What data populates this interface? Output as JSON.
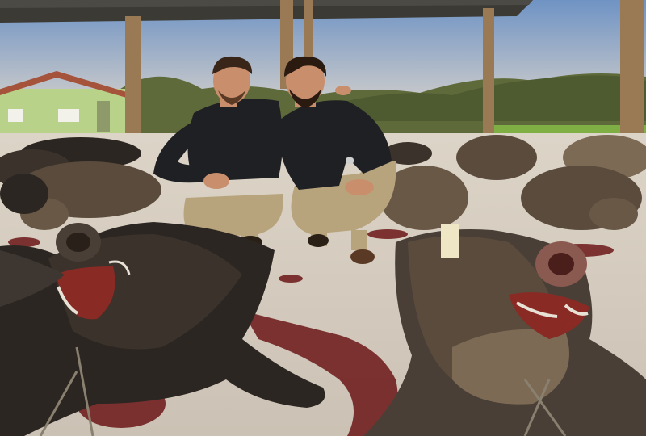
{
  "photo": {
    "description_tags": [
      "hunters",
      "wild-boar",
      "outdoor"
    ],
    "tag_text": ""
  },
  "colors": {
    "sky_top": "#6f93c4",
    "sky_bottom": "#e9dccb",
    "canopy": "#3c3a35",
    "post": "#9a7a55",
    "ground": "#d8cfc3",
    "blood": "#6b1616",
    "boar_dark": "#2b2622",
    "boar_mid": "#5a4b3c",
    "boar_light": "#7c6a55",
    "trees": "#5f6a3a",
    "grass": "#7fae45",
    "house_wall": "#b9d28a",
    "house_roof": "#a5533a",
    "sweater": "#1e2024",
    "trousers": "#b8a47c",
    "skin": "#c98f6d",
    "hair": "#3a2618"
  }
}
